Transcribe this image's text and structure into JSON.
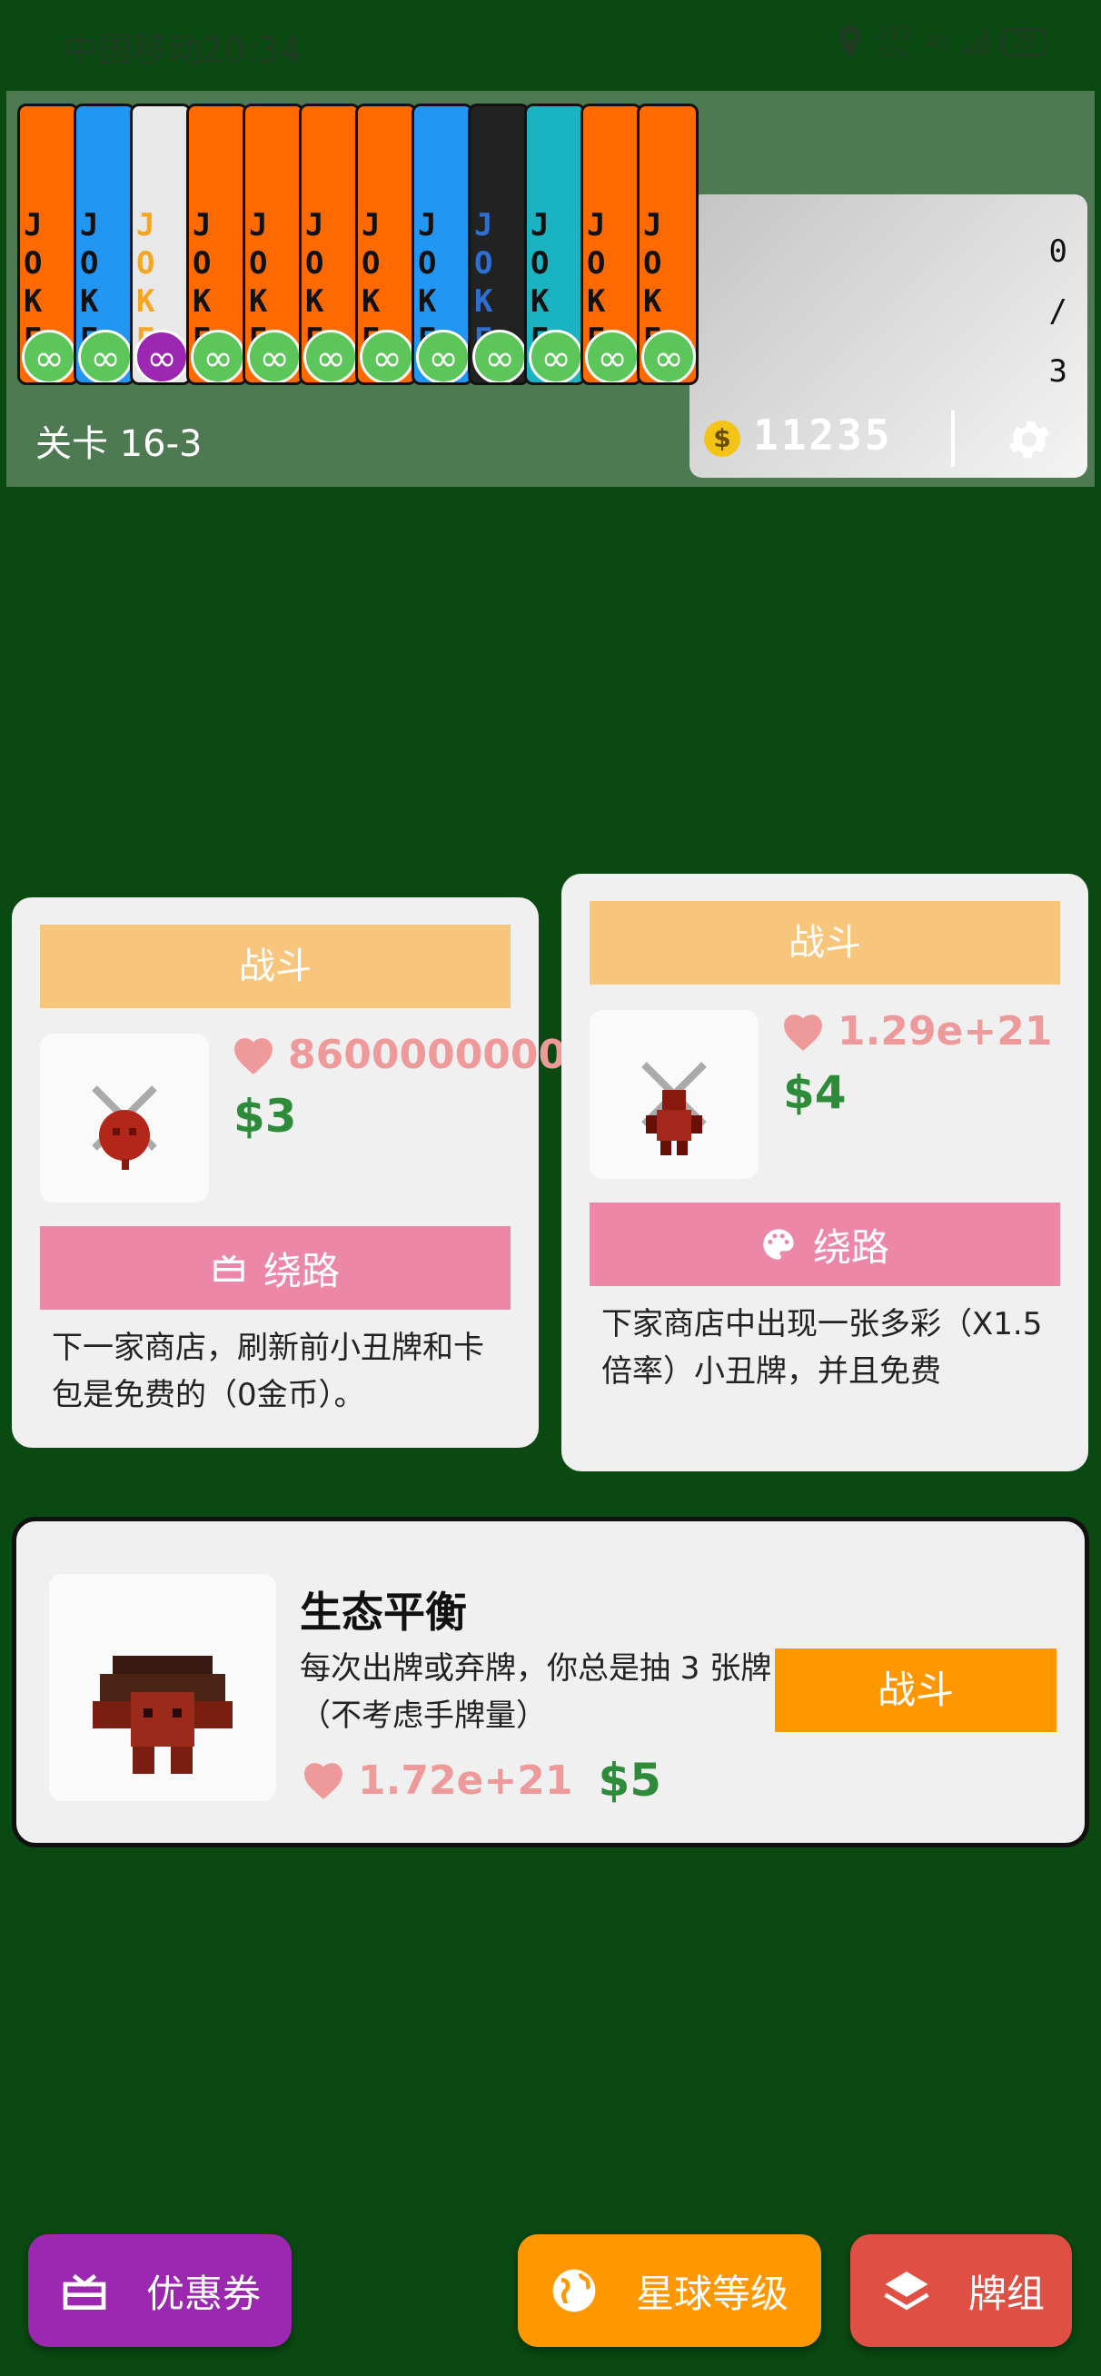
{
  "status_bar": {
    "time": "中国移动20:34",
    "speed_top": "393",
    "speed_bottom": "K/s",
    "network": "4G",
    "battery": "29"
  },
  "top_panel": {
    "joker_text": "JOKE",
    "counter": [
      "0",
      "/",
      "3"
    ],
    "level_label": "关卡 16-3",
    "coin_symbol": "$",
    "coins": "11235",
    "infinity": "∞"
  },
  "cards": [
    {
      "fight_label": "战斗",
      "hp": "8600000000",
      "money": "$3",
      "detour_label": "绕路",
      "description": "下一家商店，刷新前小丑牌和卡包是免费的（0金币）。"
    },
    {
      "fight_label": "战斗",
      "hp": "1.29e+21",
      "money": "$4",
      "detour_label": "绕路",
      "description": "下家商店中出现一张多彩（X1.5倍率）小丑牌，并且免费"
    }
  ],
  "boss": {
    "name": "生态平衡",
    "description": "每次出牌或弃牌，你总是抽 3 张牌（不考虑手牌量）",
    "hp": "1.72e+21",
    "money": "$5",
    "fight_label": "战斗"
  },
  "bottom_nav": {
    "coupon_label": "优惠券",
    "planet_label": "星球等级",
    "deck_label": "牌组"
  },
  "colors": {
    "background": "#0a4a12",
    "fight_light": "#f8c57c",
    "detour": "#ec87a8",
    "boss_fight": "#ff9800",
    "coupon": "#9c27b0",
    "planet": "#ff9800",
    "deck": "#e04f44"
  }
}
